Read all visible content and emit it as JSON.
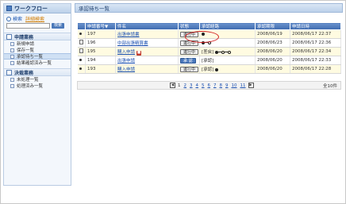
{
  "sidebar": {
    "title": "ワークフロー",
    "search_label": "検索",
    "advanced_search": "詳細検索",
    "search_button": "検索",
    "sections": [
      {
        "title": "申請業務",
        "items": [
          {
            "label": "新規申請"
          },
          {
            "label": "保存一覧"
          },
          {
            "label": "承認待ち一覧"
          },
          {
            "label": "結果確認済み一覧"
          }
        ]
      },
      {
        "title": "決裁業務",
        "items": [
          {
            "label": "未処理一覧"
          },
          {
            "label": "処理済み一覧"
          }
        ]
      }
    ]
  },
  "main": {
    "title": "承認待ち一覧",
    "table": {
      "headers": [
        "",
        "申請番号▼",
        "件名",
        "状態",
        "承認経路",
        "承認期限",
        "申請日時"
      ],
      "rows": [
        {
          "num": "197",
          "title": "出張申請書",
          "status": "進行中",
          "route": "●",
          "deadline": "2008/06/19",
          "datetime": "2008/06/17 22:37"
        },
        {
          "num": "196",
          "title": "中部出張精算書",
          "status": "進行中",
          "route": "●-○",
          "deadline": "2008/06/23",
          "datetime": "2008/06/17 22:36"
        },
        {
          "num": "195",
          "title": "購入申請",
          "status": "進行中",
          "route": "[差戻] ●-○-○",
          "deadline": "2008/06/20",
          "datetime": "2008/06/17 22:34"
        },
        {
          "num": "194",
          "title": "出張申請",
          "status": "承 認",
          "route": "[承認]",
          "deadline": "2008/06/20",
          "datetime": "2008/06/17 22:33"
        },
        {
          "num": "193",
          "title": "購入申請",
          "status": "進行中",
          "route": "[承認] ●",
          "deadline": "2008/06/20",
          "datetime": "2008/06/17 22:28"
        }
      ]
    },
    "pager": {
      "pages": [
        "1",
        "2",
        "3",
        "4",
        "5",
        "6",
        "7",
        "8",
        "9",
        "10",
        "11"
      ],
      "total": "全10件"
    }
  }
}
